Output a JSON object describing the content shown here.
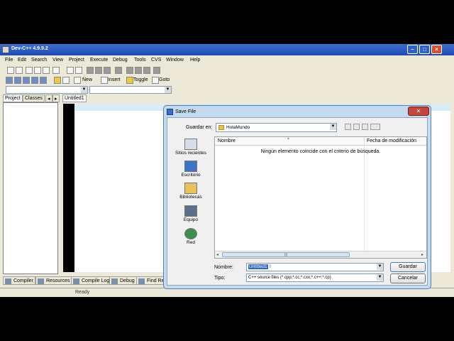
{
  "ide": {
    "title": "Dev-C++ 4.9.9.2",
    "menu": [
      "File",
      "Edit",
      "Search",
      "View",
      "Project",
      "Execute",
      "Debug",
      "Tools",
      "CVS",
      "Window",
      "Help"
    ],
    "toolbar2": {
      "new": "New",
      "insert": "Insert",
      "toggle": "Toggle",
      "goto": "Goto"
    },
    "panel_tabs": [
      "Project",
      "Classes"
    ],
    "editor_tab": "Untitled1",
    "bottom_tabs": [
      "Compiler",
      "Resources",
      "Compile Log",
      "Debug",
      "Find Res"
    ],
    "status": "Ready"
  },
  "dialog": {
    "title": "Save File",
    "save_in_label": "Guardar en:",
    "save_in_value": "HolaMundo",
    "places": [
      "Sitios recientes",
      "Escritorio",
      "Bibliotecas",
      "Equipo",
      "Red"
    ],
    "columns": {
      "name": "Nombre",
      "date": "Fecha de modificación"
    },
    "empty_message": "Ningún elemento coincide con el criterio de búsqueda.",
    "name_label": "Nombre:",
    "name_value": "Untitled1",
    "type_label": "Tipo:",
    "type_value": "C++ source files (*.cpp;*.cc;*.cxx;*.c++;*.cp)",
    "save_button": "Guardar",
    "cancel_button": "Cancelar"
  }
}
